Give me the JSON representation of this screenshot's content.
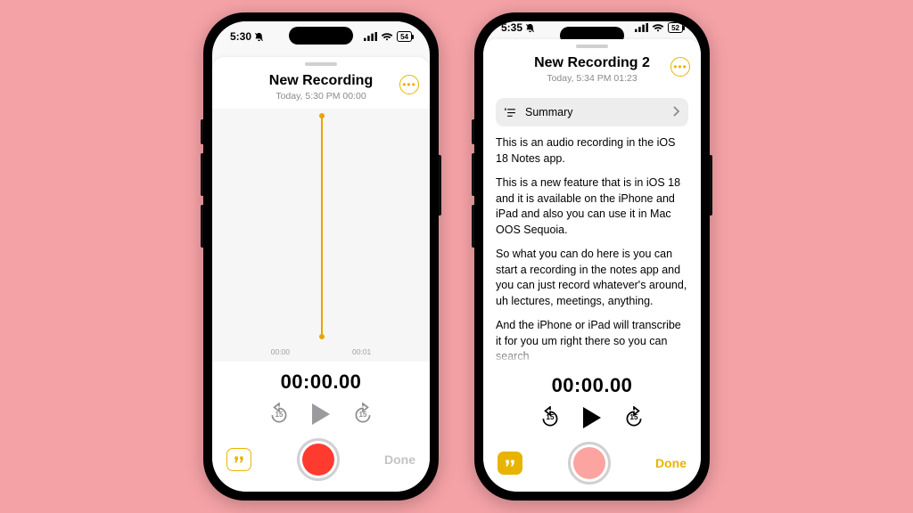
{
  "colors": {
    "accent": "#e9b400",
    "record": "#ff3b30",
    "recordInactive": "#fca4a0",
    "bg": "#f5a2a6"
  },
  "phone1": {
    "status": {
      "time": "5:30",
      "battery": "54"
    },
    "title": "New Recording",
    "subtitle": "Today, 5:30 PM  00:00",
    "waveform_ticks": [
      "00:00",
      "00:01"
    ],
    "timer": "00:00.00",
    "skip_seconds": "15",
    "done_label": "Done"
  },
  "phone2": {
    "status": {
      "time": "5:35",
      "battery": "52"
    },
    "title": "New Recording 2",
    "subtitle": "Today, 5:34 PM  01:23",
    "summary_label": "Summary",
    "transcript": [
      "This is an audio recording in the iOS 18 Notes app.",
      "This is a new feature that is in iOS 18 and it is available on the iPhone and iPad and also you can use it in Mac OOS Sequoia.",
      "So what you can do here is you can start a recording in the notes app and you can just record whatever's around, uh lectures, meetings, anything.",
      "And the iPhone or iPad will transcribe it for you um right there so you can search"
    ],
    "timer": "00:00.00",
    "skip_seconds": "15",
    "done_label": "Done"
  }
}
